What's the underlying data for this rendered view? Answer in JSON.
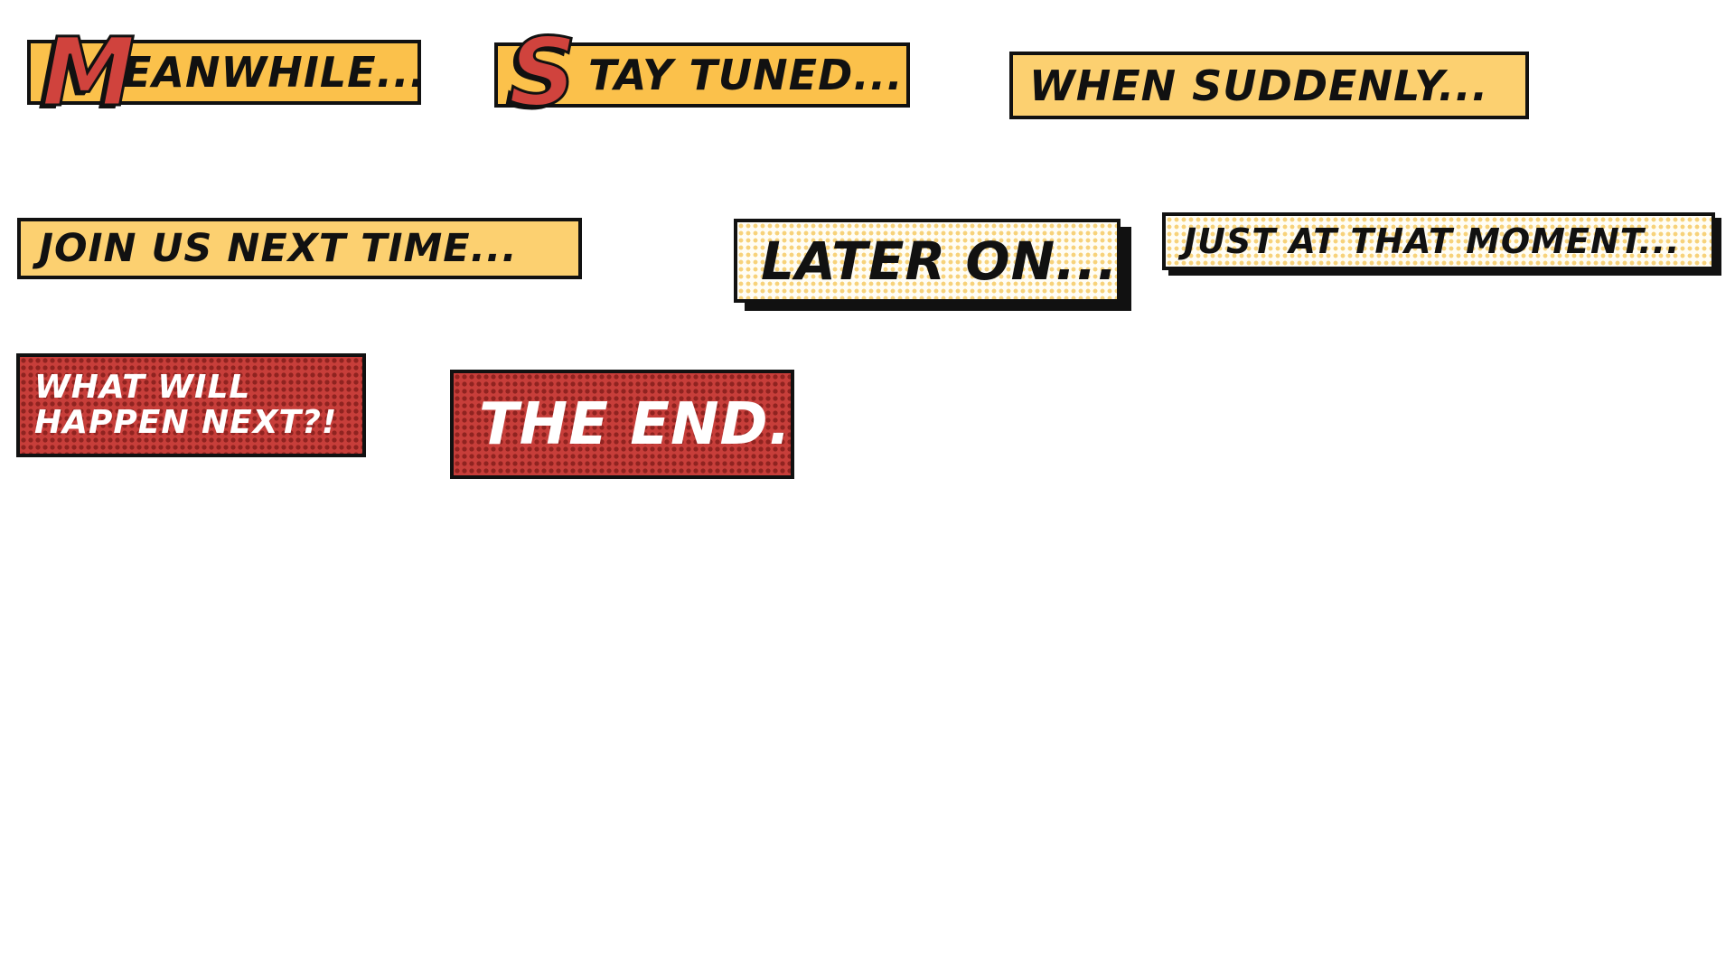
{
  "captions": {
    "meanwhile": {
      "initial": "M",
      "rest": "EANWHILE..."
    },
    "stay_tuned": {
      "initial": "S",
      "rest": "TAY TUNED..."
    },
    "when_suddenly": {
      "text": "WHEN SUDDENLY..."
    },
    "join_us": {
      "text": "JOIN US NEXT TIME..."
    },
    "later_on": {
      "text": "LATER ON..."
    },
    "just_at_that_moment": {
      "text": "JUST AT THAT MOMENT..."
    },
    "what_will_happen": {
      "line1": "WHAT WILL",
      "line2": "HAPPEN NEXT?!"
    },
    "the_end": {
      "text": "THE END."
    }
  },
  "colors": {
    "caption_yellow": "#fbc14b",
    "caption_pale_yellow": "#fcd070",
    "halftone_yellow_dot": "#f7d27a",
    "caption_red": "#c73e3a",
    "halftone_red_dot": "#8f2320",
    "outline": "#111111",
    "initial_letter_red": "#d0433d"
  }
}
